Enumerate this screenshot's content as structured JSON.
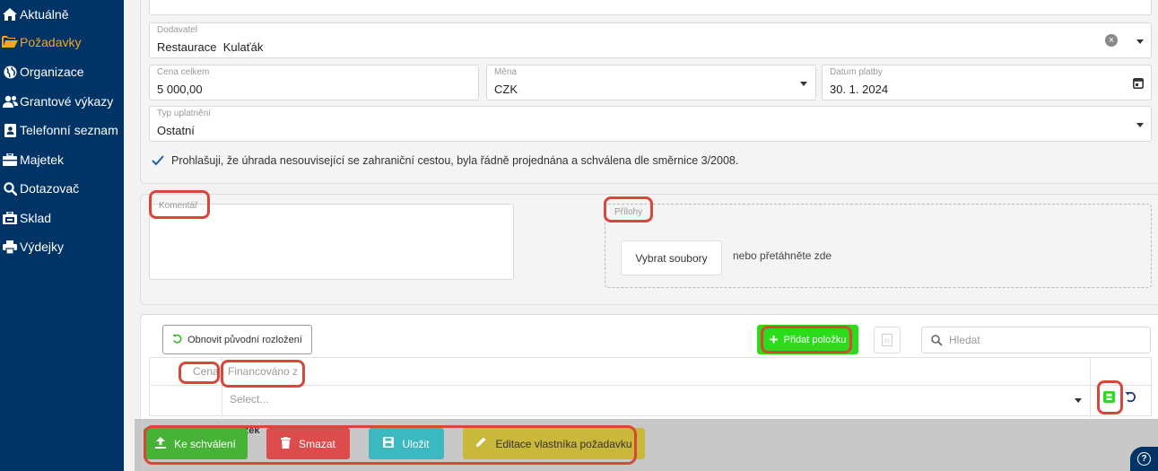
{
  "sidebar": {
    "items": [
      {
        "label": "Aktuálně",
        "icon": "home-icon"
      },
      {
        "label": "Požadavky",
        "icon": "folder-open-icon",
        "active": true
      },
      {
        "label": "Organizace",
        "icon": "globe-icon"
      },
      {
        "label": "Grantové výkazy",
        "icon": "users-icon"
      },
      {
        "label": "Telefonní seznam",
        "icon": "contact-book-icon"
      },
      {
        "label": "Majetek",
        "icon": "toolbox-icon"
      },
      {
        "label": "Dotazovač",
        "icon": "search-icon"
      },
      {
        "label": "Sklad",
        "icon": "warehouse-icon"
      },
      {
        "label": "Výdejky",
        "icon": "printer-icon"
      }
    ]
  },
  "form": {
    "supplier": {
      "label": "Dodavatel",
      "value": "Restaurace  Kulaťák"
    },
    "total": {
      "label": "Cena celkem",
      "value": "5 000,00"
    },
    "currency": {
      "label": "Měna",
      "value": "CZK"
    },
    "payment_date": {
      "label": "Datum platby",
      "value": "30. 1. 2024"
    },
    "claim_type": {
      "label": "Typ uplatnění",
      "value": "Ostatní"
    },
    "declaration": "Prohlašuji, že úhrada nesouvisející se zahraniční cestou, byla řádně projednána a schválena dle směrnice 3/2008."
  },
  "comment": {
    "label": "Komentář"
  },
  "attachments": {
    "label": "Přílohy",
    "select_button": "Vybrat soubory",
    "drop_hint": "nebo přetáhněte zde"
  },
  "items": {
    "reset_layout": "Obnovit původní rozložení",
    "add_item": "Přidat položku",
    "search_placeholder": "Hledat",
    "columns": [
      "Cena",
      "Financováno z"
    ],
    "select_placeholder": "Select...",
    "partial_text": "ožek"
  },
  "actions": {
    "submit": "Ke schválení",
    "delete": "Smazat",
    "save": "Uložit",
    "edit_owner": "Editace vlastníka požadavku"
  },
  "colors": {
    "sidebar_bg": "#003366",
    "active": "#f5a623",
    "green": "#46b336",
    "red": "#dc4c4c",
    "teal": "#3bb8c0",
    "olive": "#c9b83a",
    "highlight": "#d9473b"
  }
}
